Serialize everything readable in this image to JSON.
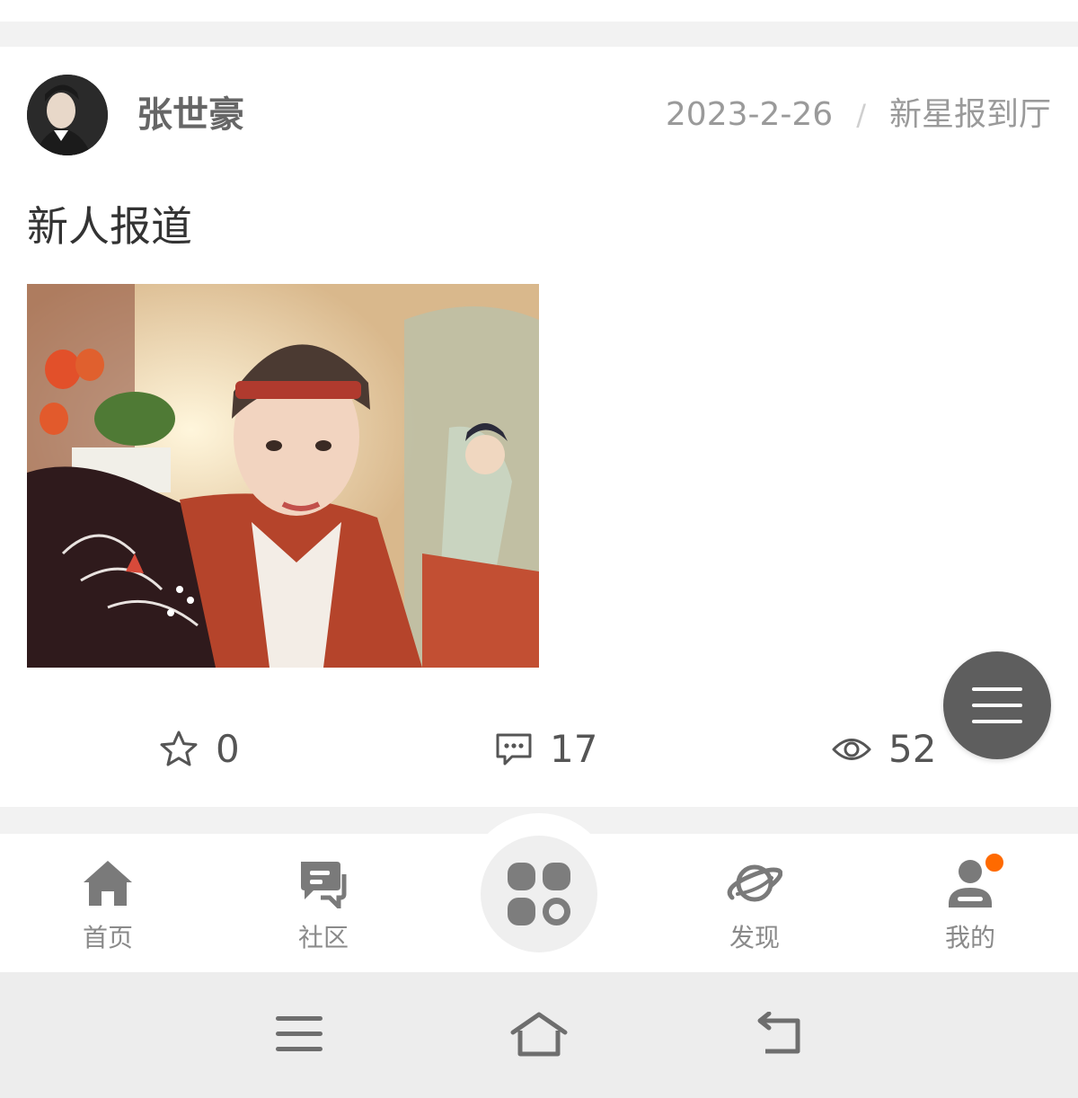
{
  "post": {
    "author": "张世豪",
    "date": "2023-2-26",
    "separator": "/",
    "category": "新星报到厅",
    "title": "新人报道",
    "stats": {
      "likes": "0",
      "comments": "17",
      "views": "52"
    }
  },
  "tabbar": {
    "items": [
      {
        "label": "首页",
        "icon": "home-icon"
      },
      {
        "label": "社区",
        "icon": "chat-bubbles-icon"
      },
      {
        "label": "",
        "icon": "grid-apps-icon"
      },
      {
        "label": "发现",
        "icon": "planet-icon"
      },
      {
        "label": "我的",
        "icon": "user-icon"
      }
    ],
    "accent_badge_color": "#ff6a00"
  },
  "system_nav": {
    "icons": [
      "menu-icon",
      "home-outline-icon",
      "back-icon"
    ]
  }
}
